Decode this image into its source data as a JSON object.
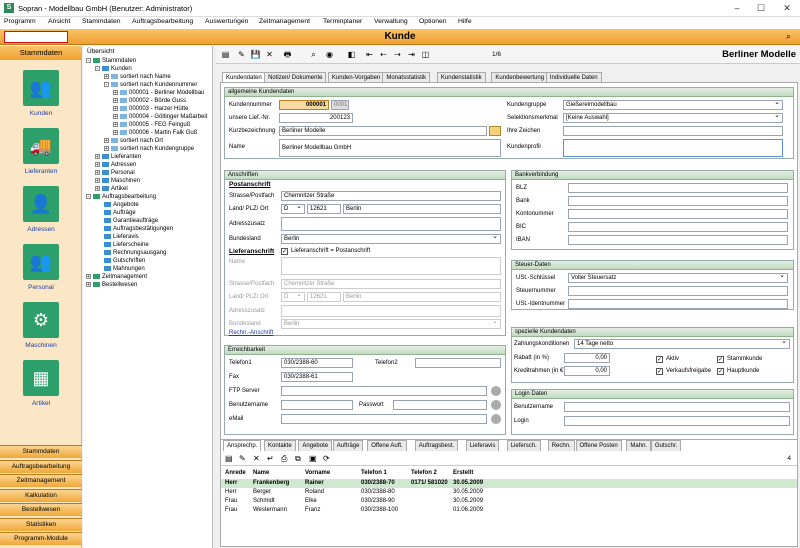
{
  "window": {
    "title": "Sopran - Modellbau GmbH (Benutzer: Administrator)",
    "app_icon": "S"
  },
  "menu": [
    "Programm",
    "Ansicht",
    "Stammdaten",
    "Auftragsbearbeitung",
    "Auswertungen",
    "Zeitmanagement",
    "Terminplaner",
    "Verwaltung",
    "Optionen",
    "Hilfe"
  ],
  "header": {
    "title": "Kunde",
    "search_value": ""
  },
  "leftnav": {
    "header": "Stammdaten",
    "items": [
      {
        "label": "Kunden",
        "icon": "customers-icon"
      },
      {
        "label": "Lieferanten",
        "icon": "truck-icon"
      },
      {
        "label": "Adressen",
        "icon": "address-book-icon"
      },
      {
        "label": "Personal",
        "icon": "staff-icon"
      },
      {
        "label": "Maschinen",
        "icon": "machine-icon"
      },
      {
        "label": "Artikel",
        "icon": "articles-icon"
      }
    ],
    "bottom_tabs": [
      "Stammdaten",
      "Auftragsbearbeitung",
      "Zeitmanagement",
      "Kalkulation",
      "Bestellwesen",
      "Statistiken",
      "Programm-Module"
    ]
  },
  "tree": {
    "title": "Übersicht",
    "nodes": [
      {
        "t": "Stammdaten",
        "d": 0,
        "e": "-"
      },
      {
        "t": "Kunden",
        "d": 1,
        "e": "-"
      },
      {
        "t": "sortiert nach Name",
        "d": 2,
        "e": "+"
      },
      {
        "t": "sortiert nach Kundennummer",
        "d": 2,
        "e": "-"
      },
      {
        "t": "000001 - Berliner Modellbau",
        "d": 3,
        "e": "+"
      },
      {
        "t": "000002 - Börde Guss",
        "d": 3,
        "e": "+"
      },
      {
        "t": "000003 - Harzer Hütte",
        "d": 3,
        "e": "+"
      },
      {
        "t": "000004 - Göltinger Maßarbeit",
        "d": 3,
        "e": "+"
      },
      {
        "t": "000005 - FEG Feinguß",
        "d": 3,
        "e": "+"
      },
      {
        "t": "000006 - Martin Falk Guß",
        "d": 3,
        "e": "+"
      },
      {
        "t": "sortiert nach Ort",
        "d": 2,
        "e": "+"
      },
      {
        "t": "sortiert nach Kundengruppe",
        "d": 2,
        "e": "+"
      },
      {
        "t": "Lieferanten",
        "d": 1,
        "e": "+"
      },
      {
        "t": "Adressen",
        "d": 1,
        "e": "+"
      },
      {
        "t": "Personal",
        "d": 1,
        "e": "+"
      },
      {
        "t": "Maschinen",
        "d": 1,
        "e": "+"
      },
      {
        "t": "Artikel",
        "d": 1,
        "e": "+"
      },
      {
        "t": "Auftragsbearbeitung",
        "d": 0,
        "e": "-"
      },
      {
        "t": "Angebote",
        "d": 1,
        "e": ""
      },
      {
        "t": "Aufträge",
        "d": 1,
        "e": ""
      },
      {
        "t": "Garantieaufträge",
        "d": 1,
        "e": ""
      },
      {
        "t": "Auftragsbestätigungen",
        "d": 1,
        "e": ""
      },
      {
        "t": "Lieferavis",
        "d": 1,
        "e": ""
      },
      {
        "t": "Lieferscheine",
        "d": 1,
        "e": ""
      },
      {
        "t": "Rechnungsausgang",
        "d": 1,
        "e": ""
      },
      {
        "t": "Gutschriften",
        "d": 1,
        "e": ""
      },
      {
        "t": "Mahnungen",
        "d": 1,
        "e": ""
      },
      {
        "t": "Zeitmanagement",
        "d": 0,
        "e": "+"
      },
      {
        "t": "Bestellwesen",
        "d": 0,
        "e": "+"
      }
    ]
  },
  "toolbar": {
    "record_count": "1/6",
    "right_title": "Berliner Modelle"
  },
  "tabs": [
    "Kundendaten",
    "Notizen/ Dokumente",
    "Kunden-Vorgaben",
    "Monatsstatistik",
    "Kundenstatistik",
    "Kundenbewertung",
    "Individuelle Daten"
  ],
  "general": {
    "header": "allgemeine Kundendaten",
    "kundennummer_label": "Kundennummer",
    "kundennummer": "000001",
    "kundennummer_btn": "0001",
    "lief_label": "unsere Lief.-Nr.",
    "lief": "200123",
    "kurz_label": "Kurzbezeichnung",
    "kurz": "Berliner Modelle",
    "name_label": "Name",
    "name": "Berliner Modellbau GmbH",
    "gruppe_label": "Kundengruppe",
    "gruppe": "Gießereimodellbau",
    "selekt_label": "Selektionsmerkmal",
    "selekt": "[Keine Auswahl]",
    "zeichen_label": "Ihre Zeichen",
    "zeichen": "",
    "profil_label": "Kundenprofil",
    "profil": ""
  },
  "anschrift": {
    "header": "Anschriften",
    "post_title": "Postanschrift",
    "strasse_label": "Strasse/Postfach",
    "strasse": "Chemnitzer Straße",
    "land_label": "Land/ PLZ/ Ort",
    "land": "D",
    "plz": "12621",
    "ort": "Berlin",
    "zusatz_label": "Adresszusatz",
    "zusatz": "",
    "bl_label": "Bundesland",
    "bl": "Berlin",
    "lief_title": "Lieferanschrift",
    "lief_chk": "Lieferanschrift = Postanschrift",
    "l_name_label": "Name",
    "l_name": "",
    "l_strasse_label": "Strasse/Postfach",
    "l_strasse": "Chemnitzer Straße",
    "l_land_label": "Land/ PLZ/ Ort",
    "l_land": "D",
    "l_plz": "12621",
    "l_ort": "Berlin",
    "l_zusatz_label": "Adresszusatz",
    "l_zusatz": "",
    "l_bl_label": "Bundesland",
    "l_bl": "Berlin",
    "link": "Rechn.-Anschrift"
  },
  "bank": {
    "header": "Bankverbindung",
    "rows": [
      "BLZ",
      "Bank",
      "Kontonummer",
      "BIC",
      "IBAN"
    ]
  },
  "steuer": {
    "header": "Steuer-Daten",
    "ust_label": "USt.-Schlüssel",
    "ust": "Voller Steuersatz",
    "snr_label": "Steuernummer",
    "snr": "",
    "uid_label": "USt.-Identnummer",
    "uid": ""
  },
  "spezielle": {
    "header": "spezielle Kundendaten",
    "zahlung_label": "Zahlungskonditionen",
    "zahlung": "14 Tage netto",
    "rabatt_label": "Rabatt (in %)",
    "rabatt": "0,00",
    "kredit_label": "Kreditrahmen (in €)",
    "kredit": "0,00",
    "checks": [
      {
        "label": "Aktiv",
        "checked": true
      },
      {
        "label": "Stammkunde",
        "checked": true
      },
      {
        "label": "Verkaufsfreigabe",
        "checked": true
      },
      {
        "label": "Hauptkunde",
        "checked": true
      }
    ]
  },
  "erreich": {
    "header": "Erreichbarkeit",
    "tel1_label": "Telefon1",
    "tel1": "030/2388-60",
    "tel2_label": "Telefon2",
    "tel2": "",
    "fax_label": "Fax",
    "fax": "030/2388-61",
    "ftp_label": "FTP Server",
    "ftp": "",
    "user_label": "Benutzername",
    "user": "",
    "pw_label": "Passwort",
    "pw": "",
    "email_label": "eMail",
    "email": ""
  },
  "login": {
    "header": "Login Daten",
    "user_label": "Benutzername",
    "login_label": "Login"
  },
  "bottom": {
    "tabs": [
      "Ansprechp.",
      "Kontakte",
      "Angebote",
      "Aufträge",
      "Offene Auft.",
      "Auftragsbest.",
      "Lieferavis",
      "Liefersch.",
      "Rechn.",
      "Offene Posten",
      "Mahn.",
      "Gutschr."
    ],
    "count": "4",
    "columns": [
      "Anrede",
      "Name",
      "Vorname",
      "Telefon 1",
      "Telefon 2",
      "Erstellt"
    ],
    "rows": [
      [
        "Herr",
        "Frankenberg",
        "Rainer",
        "030/2388-70",
        "0171/ 581020",
        "30.05.2009"
      ],
      [
        "Herr",
        "Berger",
        "Roland",
        "030/2388-80",
        "",
        "30.05.2009"
      ],
      [
        "Frau",
        "Schmidt",
        "Elke",
        "030/2388-90",
        "",
        "30.05.2009"
      ],
      [
        "Frau",
        "Westermann",
        "Franz",
        "030/2388-100",
        "",
        "01.06.2009"
      ]
    ]
  },
  "colors": {
    "accent": "#f0a030",
    "header_green": "#c2dbc2",
    "selected_row": "#cfe8cf",
    "nav_icon": "#2d9f6a"
  }
}
